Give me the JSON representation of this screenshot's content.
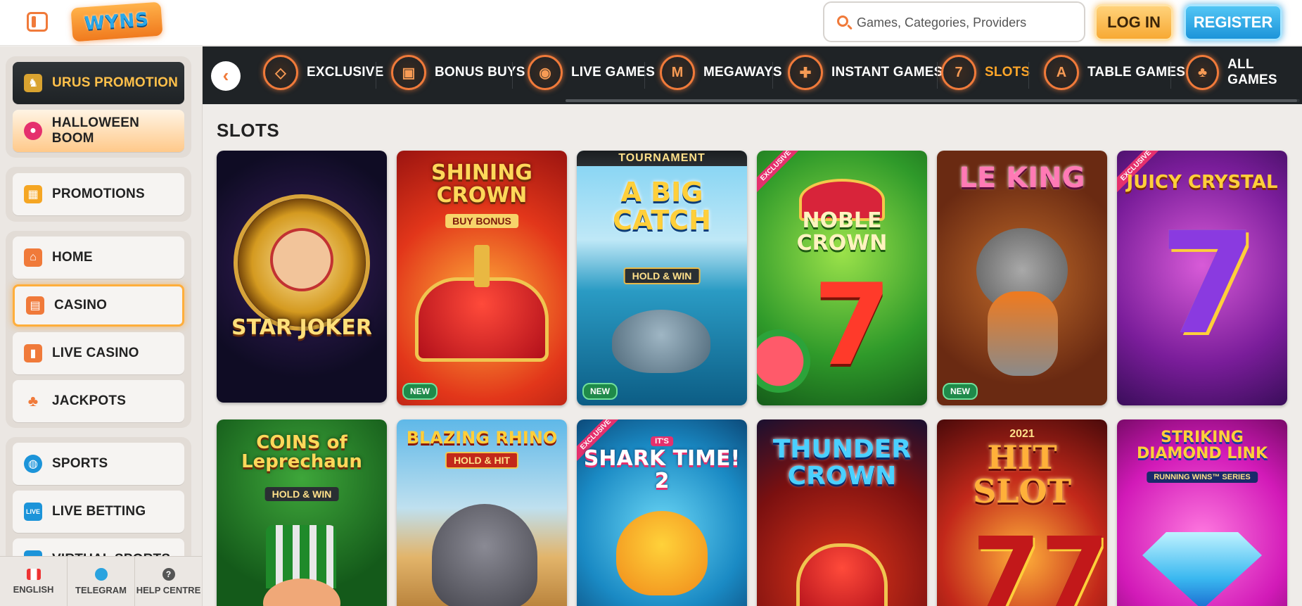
{
  "header": {
    "logo_text": "WYNS",
    "search_placeholder": "Games, Categories, Providers",
    "login_label": "LOG IN",
    "register_label": "REGISTER"
  },
  "sidebar": {
    "promos": [
      {
        "label": "URUS PROMOTION",
        "icon": "bull-icon"
      },
      {
        "label": "HALLOWEEN BOOM",
        "icon": "pumpkin-icon"
      }
    ],
    "promotions": {
      "label": "PROMOTIONS",
      "icon": "gift-icon"
    },
    "main_nav": [
      {
        "label": "HOME",
        "icon": "home-icon"
      },
      {
        "label": "CASINO",
        "icon": "slot-machine-icon",
        "active": true
      },
      {
        "label": "LIVE CASINO",
        "icon": "cards-icon"
      },
      {
        "label": "JACKPOTS",
        "icon": "clover-icon"
      }
    ],
    "sports_nav": [
      {
        "label": "SPORTS",
        "icon": "ball-icon"
      },
      {
        "label": "LIVE BETTING",
        "icon": "live-icon"
      },
      {
        "label": "VIRTUAL SPORTS",
        "icon": "virtual-icon"
      }
    ],
    "bottom": [
      {
        "label": "ENGLISH",
        "icon": "flag-icon"
      },
      {
        "label": "TELEGRAM",
        "icon": "telegram-icon"
      },
      {
        "label": "HELP CENTRE",
        "icon": "help-icon"
      }
    ]
  },
  "categories": [
    {
      "label": "EXCLUSIVE",
      "icon": "diamond-icon",
      "glyph": "◇"
    },
    {
      "label": "BONUS BUYS",
      "icon": "gift-box-icon",
      "glyph": "▣"
    },
    {
      "label": "LIVE GAMES",
      "icon": "chip-icon",
      "glyph": "◉"
    },
    {
      "label": "MEGAWAYS",
      "icon": "megaways-icon",
      "glyph": "M"
    },
    {
      "label": "INSTANT GAMES",
      "icon": "gamepad-icon",
      "glyph": "✚"
    },
    {
      "label": "SLOTS",
      "icon": "slots-777-icon",
      "glyph": "7",
      "active": true
    },
    {
      "label": "TABLE GAMES",
      "icon": "playing-card-icon",
      "glyph": "A"
    },
    {
      "label": "ALL GAMES",
      "icon": "cherries-icon",
      "glyph": "♣"
    }
  ],
  "section_title": "SLOTS",
  "games_row1": [
    {
      "title": "STAR JOKER",
      "badge": "",
      "ribbon": "",
      "sub": ""
    },
    {
      "title": "SHINING CROWN",
      "badge": "NEW",
      "ribbon": "",
      "sub": "BUY BONUS"
    },
    {
      "title": "A BIG CATCH",
      "badge": "NEW",
      "ribbon": "",
      "sub": "HOLD & WIN",
      "top": "TOURNAMENT"
    },
    {
      "title": "NOBLE CROWN",
      "badge": "",
      "ribbon": "EXCLUSIVE",
      "sub": ""
    },
    {
      "title": "LE KING",
      "badge": "NEW",
      "ribbon": "",
      "sub": ""
    },
    {
      "title": "JUICY CRYSTAL",
      "badge": "",
      "ribbon": "EXCLUSIVE",
      "sub": ""
    }
  ],
  "games_row2": [
    {
      "title": "COINS of Leprechaun",
      "ribbon": "",
      "sub": "HOLD & WIN"
    },
    {
      "title": "BLAZING RHINO",
      "ribbon": "",
      "sub": "HOLD & HIT"
    },
    {
      "title": "SHARK TIME! 2",
      "ribbon": "EXCLUSIVE",
      "sub": "IT'S"
    },
    {
      "title": "THUNDER CROWN",
      "ribbon": "",
      "sub": ""
    },
    {
      "title": "HIT SLOT",
      "ribbon": "",
      "sub": "2021"
    },
    {
      "title": "STRIKING DIAMOND LINK",
      "ribbon": "",
      "sub": "RUNNING WINS™ SERIES"
    }
  ]
}
